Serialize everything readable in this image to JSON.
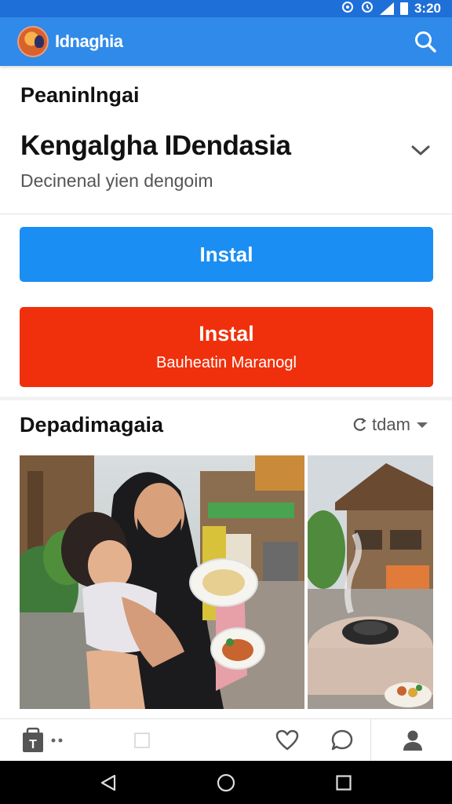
{
  "status_bar": {
    "time": "3:20"
  },
  "app_bar": {
    "app_name": "Idnaghia",
    "logo_icon": "app-logo",
    "search_icon": "search-icon"
  },
  "header": {
    "section_label": "Peaninlngai",
    "title": "Kengalgha IDendasia",
    "subtitle": "Decinenal yien dengoim"
  },
  "buttons": {
    "primary_label": "Instal",
    "secondary_label": "Instal",
    "secondary_sublabel": "Bauheatin Maranogl"
  },
  "gallery": {
    "title": "Depadimagaia",
    "sort_label": "tdam",
    "photos": [
      {
        "name": "photo-mother-child-food"
      },
      {
        "name": "photo-street-grill-table"
      }
    ]
  },
  "bottom_bar": {
    "items": [
      "shop-icon",
      "dots-icon",
      "square-icon",
      "heart-icon",
      "chat-icon",
      "profile-icon"
    ]
  },
  "nav_bar": {
    "items": [
      "back-icon",
      "home-icon",
      "recents-icon"
    ]
  },
  "colors": {
    "status_bar": "#1f6fd8",
    "app_bar": "#2f8ae9",
    "primary_button": "#1a8ef2",
    "secondary_button": "#f0300c"
  }
}
